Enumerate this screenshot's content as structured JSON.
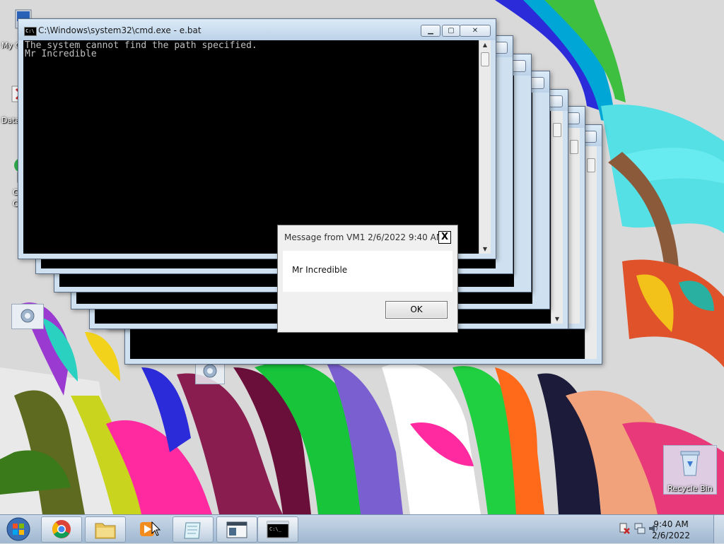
{
  "desktop": {
    "icons": [
      {
        "label": "My C",
        "icon": "computer-icon"
      },
      {
        "label": "Data",
        "icon": "shortcut-icon"
      },
      {
        "label": "G",
        "icon": "shortcut-icon"
      },
      {
        "label": "C",
        "icon": "shortcut-icon"
      },
      {
        "label": "Recycle Bin",
        "icon": "recycle-bin-icon"
      }
    ]
  },
  "cmd_window": {
    "title": "C:\\Windows\\system32\\cmd.exe - e.bat",
    "console_text": "The system cannot find the path specified.\nMr Incredible",
    "controls": {
      "minimize": "▁",
      "maximize": "▢",
      "close": "✕"
    }
  },
  "message_box": {
    "title": "Message from VM1 2/6/2022 9:40 AM",
    "text": "Mr Incredible",
    "ok_label": "OK",
    "close_glyph": "X"
  },
  "taskbar": {
    "items": [
      {
        "name": "start-button",
        "icon": "windows-logo-icon"
      },
      {
        "name": "chrome",
        "icon": "chrome-icon"
      },
      {
        "name": "explorer",
        "icon": "folder-icon"
      },
      {
        "name": "media-player",
        "icon": "media-player-icon"
      },
      {
        "name": "app-1",
        "icon": "notepad-icon"
      },
      {
        "name": "app-2",
        "icon": "window-icon"
      },
      {
        "name": "cmd",
        "icon": "cmd-icon",
        "active": true
      }
    ],
    "clock": {
      "time": "9:40 AM",
      "date": "2/6/2022"
    }
  },
  "colors": {
    "title_bar": "#c4d8ee",
    "console_bg": "#000000",
    "console_text": "#c0c0c0",
    "taskbar": "#b3c8de"
  }
}
